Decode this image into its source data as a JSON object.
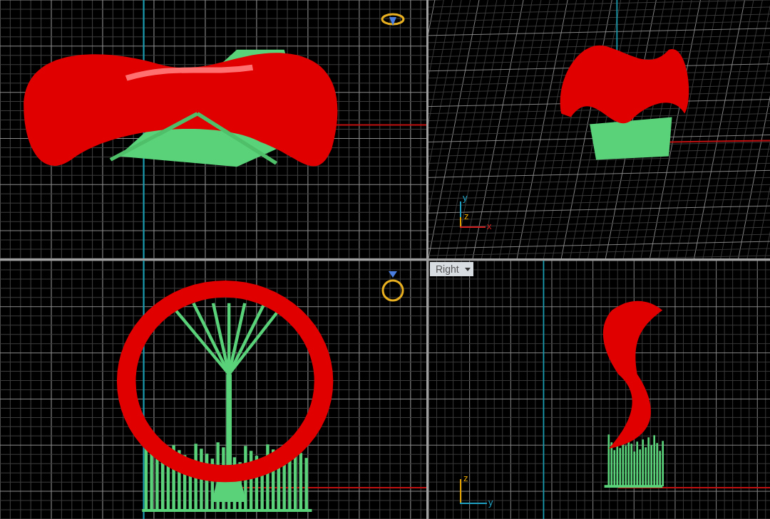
{
  "viewports": [
    {
      "kind": "band"
    },
    {
      "kind": "perspective",
      "axes": {
        "kind": "perspective",
        "labels": [
          "y",
          "z",
          "x"
        ]
      }
    },
    {
      "kind": "circle"
    },
    {
      "kind": "profile",
      "label": "Right",
      "axes": {
        "kind": "planar",
        "labels": [
          "z",
          "y"
        ]
      }
    }
  ]
}
